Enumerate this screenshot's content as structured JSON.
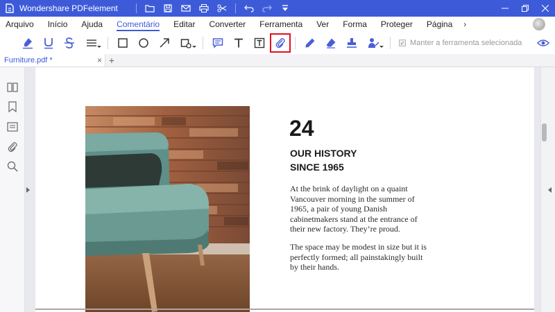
{
  "app": {
    "title": "Wondershare PDFelement",
    "colors": {
      "accent": "#3d5bd9",
      "highlight": "#e0101e",
      "tool_icon": "#4a5fd6"
    }
  },
  "quick_access": [
    "folder-icon",
    "save-icon",
    "mail-icon",
    "print-icon",
    "cut-icon",
    "undo-icon",
    "redo-icon",
    "customize-icon"
  ],
  "window_controls": [
    "minimize-icon",
    "restore-icon",
    "close-icon"
  ],
  "menu": {
    "items": [
      "Arquivo",
      "Início",
      "Ajuda",
      "Comentário",
      "Editar",
      "Converter",
      "Ferramenta",
      "Ver",
      "Forma",
      "Proteger",
      "Página"
    ],
    "active": "Comentário",
    "more": "›"
  },
  "toolbar": {
    "tools": [
      "highlight-icon",
      "underline-icon",
      "strikethrough-icon",
      "line-style-icon",
      "rectangle-icon",
      "oval-icon",
      "arrow-icon",
      "shapes-icon",
      "sticky-note-icon",
      "text-comment-icon",
      "text-box-icon",
      "attach-file-icon",
      "pencil-icon",
      "eraser-icon",
      "stamp-icon",
      "signature-icon"
    ],
    "highlighted_tool": "attach-file-icon",
    "keep_tool_label": "Manter a ferramenta selecionada",
    "keep_tool_checked": true
  },
  "tabs": {
    "document": "Furniture.pdf *",
    "close": "×",
    "add": "+"
  },
  "left_panel": [
    "thumbnails-icon",
    "bookmark-icon",
    "comments-icon",
    "attachments-icon",
    "search-icon"
  ],
  "page": {
    "number": "24",
    "heading_line1": "OUR HISTORY",
    "heading_line2": "SINCE 1965",
    "para1": "At the brink of daylight on a quaint Vancouver morning in the summer of 1965, a pair of young Danish cabinetmakers stand at the entrance of their new factory. They’re proud.",
    "para2": "The space may be modest in size but it is perfectly formed; all painstakingly built by their hands."
  }
}
